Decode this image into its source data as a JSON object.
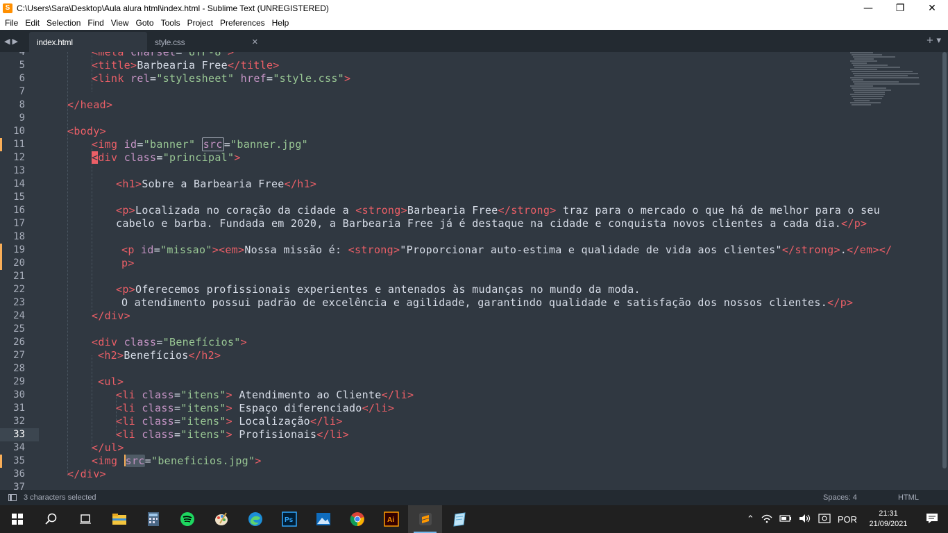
{
  "window": {
    "title": "C:\\Users\\Sara\\Desktop\\Aula alura html\\index.html - Sublime Text (UNREGISTERED)"
  },
  "menu": [
    "File",
    "Edit",
    "Selection",
    "Find",
    "View",
    "Goto",
    "Tools",
    "Project",
    "Preferences",
    "Help"
  ],
  "tabs": [
    {
      "label": "index.html",
      "active": true
    },
    {
      "label": "style.css",
      "active": false
    }
  ],
  "editor": {
    "current_line": 33,
    "first_line": 4
  },
  "status": {
    "selection": "3 characters selected",
    "spaces": "Spaces: 4",
    "syntax": "HTML"
  },
  "taskbar": {
    "apps": [
      "windows-start",
      "search",
      "task-view",
      "file-explorer",
      "calculator",
      "spotify",
      "paint",
      "edge",
      "photoshop",
      "photos",
      "chrome",
      "illustrator",
      "sublime-text",
      "notepad"
    ],
    "active_app": "sublime-text",
    "language": "POR",
    "time": "21:31",
    "date": "21/09/2021"
  },
  "colors": {
    "bg": "#303841",
    "tag": "#ec5f67",
    "attr": "#c594c5",
    "string": "#99c794",
    "punct": "#5fb4b4",
    "text": "#d8dee9",
    "modified": "#f9ae58"
  }
}
